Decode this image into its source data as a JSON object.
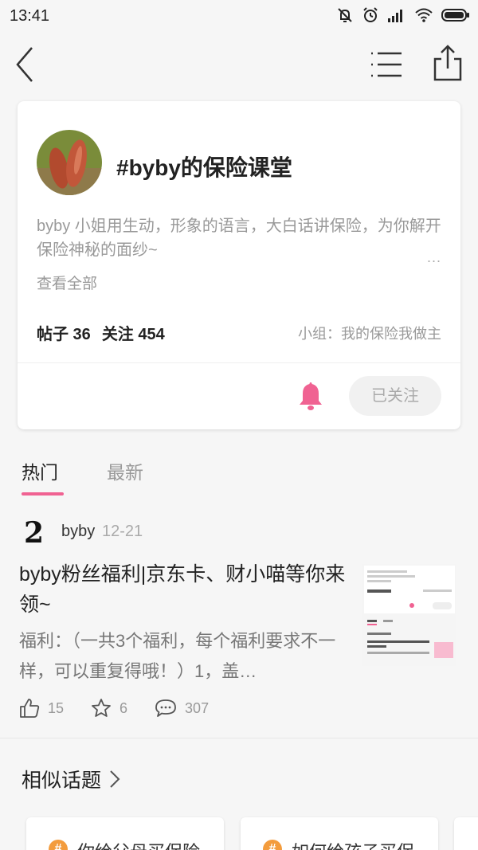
{
  "status_bar": {
    "time": "13:41"
  },
  "header": {
    "back_icon": "chevron-left-icon",
    "list_icon": "list-icon",
    "share_icon": "share-icon"
  },
  "topic": {
    "title": "#byby的保险课堂",
    "description": "byby 小姐用生动，形象的语言，大白话讲保险，为你解开保险神秘的面纱~",
    "more": "...",
    "view_all": "查看全部",
    "posts": "帖子 36",
    "follows": "关注 454",
    "group": "小组：我的保险我做主",
    "followed_label": "已关注"
  },
  "tabs": [
    {
      "label": "热门",
      "active": true
    },
    {
      "label": "最新",
      "active": false
    }
  ],
  "post": {
    "avatar_text": "2",
    "author": "byby",
    "date": "12-21",
    "title": "byby粉丝福利|京东卡、财小喵等你来领~",
    "excerpt": "福利：（一共3个福利，每个福利要求不一样，可以重复得哦！）1，盖…",
    "likes": "15",
    "stars": "6",
    "comments": "307"
  },
  "similar": {
    "title": "相似话题",
    "items": [
      {
        "label": "你给父母买保险"
      },
      {
        "label": "如何给孩子买保"
      }
    ]
  },
  "colors": {
    "accent": "#f06292",
    "hash_badge": "#f39c3d",
    "muted_text": "#999999"
  }
}
